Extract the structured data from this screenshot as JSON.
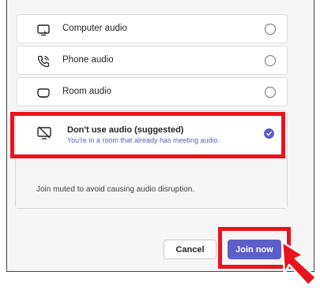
{
  "options": [
    {
      "label": "Computer audio",
      "icon": "monitor-icon"
    },
    {
      "label": "Phone audio",
      "icon": "phone-icon"
    },
    {
      "label": "Room audio",
      "icon": "room-device-icon"
    }
  ],
  "selected_option": {
    "title": "Don't use audio (suggested)",
    "subtitle": "You're in a room that already has meeting audio.",
    "icon": "no-audio-icon",
    "checked": true
  },
  "hint": "Join muted to avoid causing audio disruption.",
  "buttons": {
    "cancel": "Cancel",
    "join": "Join now"
  },
  "colors": {
    "accent": "#5b5fc7",
    "highlight": "#e8141d"
  }
}
